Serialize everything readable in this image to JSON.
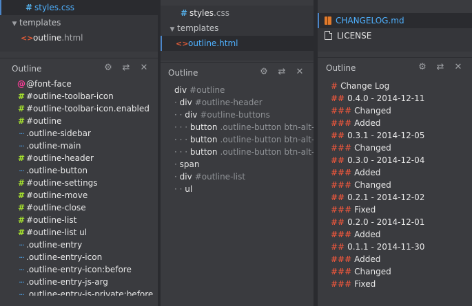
{
  "pane1": {
    "files": [
      {
        "icon": "#",
        "name": "styles",
        "ext": ".css",
        "selected": true,
        "indent": 34
      },
      {
        "icon": "▼",
        "name": "templates",
        "ext": "",
        "folder": true,
        "indent": 14
      },
      {
        "icon": "<>",
        "name": "outline",
        "ext": ".html",
        "indent": 30
      }
    ],
    "outline_title": "Outline",
    "outline": [
      {
        "sym": "@",
        "type": "at",
        "label": "@font-face"
      },
      {
        "sym": "#",
        "type": "hash",
        "label": "#outline-toolbar-icon"
      },
      {
        "sym": "#",
        "type": "hash",
        "label": "#outline-toolbar-icon.enabled"
      },
      {
        "sym": "#",
        "type": "hash",
        "label": "#outline"
      },
      {
        "sym": "···",
        "type": "dots",
        "label": ".outline-sidebar"
      },
      {
        "sym": "···",
        "type": "dots",
        "label": ".outline-main"
      },
      {
        "sym": "#",
        "type": "hash",
        "label": "#outline-header"
      },
      {
        "sym": "···",
        "type": "dots",
        "label": ".outline-button"
      },
      {
        "sym": "#",
        "type": "hash",
        "label": "#outline-settings"
      },
      {
        "sym": "#",
        "type": "hash",
        "label": "#outline-move"
      },
      {
        "sym": "#",
        "type": "hash",
        "label": "#outline-close"
      },
      {
        "sym": "#",
        "type": "hash",
        "label": "#outline-list"
      },
      {
        "sym": "#",
        "type": "hash",
        "label": "#outline-list ul"
      },
      {
        "sym": "···",
        "type": "dots",
        "label": ".outline-entry"
      },
      {
        "sym": "···",
        "type": "dots",
        "label": ".outline-entry-icon"
      },
      {
        "sym": "···",
        "type": "dots",
        "label": ".outline-entry-icon:before"
      },
      {
        "sym": "···",
        "type": "dots",
        "label": ".outline-entry-js-arg"
      },
      {
        "sym": "···",
        "type": "dots",
        "label": ".outline-entry-js-private:before"
      }
    ]
  },
  "pane2": {
    "files": [
      {
        "icon": "#",
        "name": "styles",
        "ext": ".css",
        "indent": 26
      },
      {
        "icon": "▼",
        "name": "templates",
        "ext": "",
        "folder": true,
        "indent": 10
      },
      {
        "icon": "<>",
        "name": "outline",
        "ext": ".html",
        "selected": true,
        "indent": 22
      }
    ],
    "outline_title": "Outline",
    "outline": [
      {
        "dots": "",
        "tag": "div",
        "extra": "#outline"
      },
      {
        "dots": "· ",
        "tag": "div",
        "extra": "#outline-header"
      },
      {
        "dots": "· · ",
        "tag": "div",
        "extra": "#outline-buttons"
      },
      {
        "dots": "· · · ",
        "tag": "button",
        "extra": ".outline-button btn-alt-qu"
      },
      {
        "dots": "· · · ",
        "tag": "button",
        "extra": ".outline-button btn-alt-qu"
      },
      {
        "dots": "· · · ",
        "tag": "button",
        "extra": ".outline-button btn-alt-qu"
      },
      {
        "dots": "· ",
        "tag": "span",
        "extra": ""
      },
      {
        "dots": "· ",
        "tag": "div",
        "extra": "#outline-list"
      },
      {
        "dots": "· · ",
        "tag": "ul",
        "extra": ""
      }
    ]
  },
  "pane3": {
    "files": [
      {
        "icon": "book",
        "name": "CHANGELOG",
        "ext": ".md",
        "selected": true,
        "indent": 10
      },
      {
        "icon": "file",
        "name": "LICENSE",
        "ext": "",
        "indent": 10
      }
    ],
    "outline_title": "Outline",
    "outline": [
      {
        "hash": "#",
        "text": "Change Log"
      },
      {
        "hash": "##",
        "text": "0.4.0 - 2014-12-11"
      },
      {
        "hash": "###",
        "text": "Changed"
      },
      {
        "hash": "###",
        "text": "Added"
      },
      {
        "hash": "##",
        "text": "0.3.1 - 2014-12-05"
      },
      {
        "hash": "###",
        "text": "Changed"
      },
      {
        "hash": "##",
        "text": "0.3.0 - 2014-12-04"
      },
      {
        "hash": "###",
        "text": "Added"
      },
      {
        "hash": "###",
        "text": "Changed"
      },
      {
        "hash": "##",
        "text": "0.2.1 - 2014-12-02"
      },
      {
        "hash": "###",
        "text": "Fixed"
      },
      {
        "hash": "##",
        "text": "0.2.0 - 2014-12-01"
      },
      {
        "hash": "###",
        "text": "Added"
      },
      {
        "hash": "##",
        "text": "0.1.1 - 2014-11-30"
      },
      {
        "hash": "###",
        "text": "Added"
      },
      {
        "hash": "###",
        "text": "Changed"
      },
      {
        "hash": "###",
        "text": "Fixed"
      }
    ]
  },
  "header_icons": [
    {
      "name": "gear-icon",
      "glyph": "⚙"
    },
    {
      "name": "move-icon",
      "glyph": "⇄"
    },
    {
      "name": "close-icon",
      "glyph": "✕"
    }
  ],
  "colors": {
    "accent": "#4fb1ff",
    "css_id": "#a6e22e",
    "css_at": "#ff3d9a",
    "md_hash": "#ff5a3c"
  }
}
